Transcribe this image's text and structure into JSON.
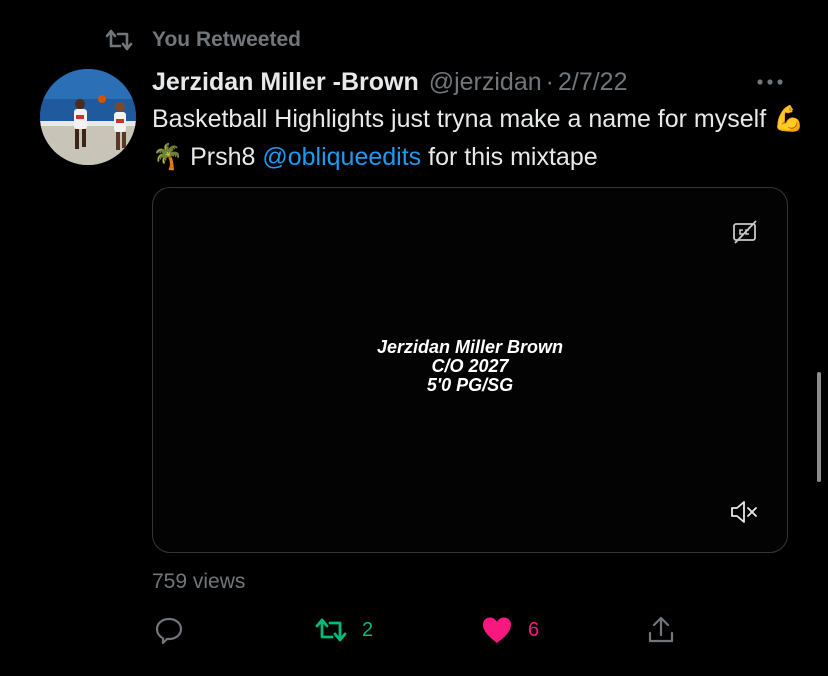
{
  "retweet_context": {
    "label": "You Retweeted",
    "icon": "retweet-icon"
  },
  "tweet": {
    "author": {
      "display_name": "Jerzidan Miller -Brown",
      "handle": "@jerzidan"
    },
    "separator": "·",
    "date": "2/7/22",
    "text": {
      "part1": "Basketball Highlights just tryna make a name for myself ",
      "emoji": "💪🌴",
      "part2": " Prsh8 ",
      "mention": "@obliqueedits",
      "part3": " for this mixtape"
    },
    "media": {
      "overlay_lines": [
        "Jerzidan Miller Brown",
        "C/O 2027",
        "5'0 PG/SG"
      ]
    },
    "views": "759 views",
    "actions": {
      "retweet_count": "2",
      "like_count": "6"
    }
  },
  "colors": {
    "background": "#000000",
    "text_primary": "#e7e9ea",
    "text_secondary": "#71767b",
    "link": "#1d9bf0",
    "retweet_active": "#00ba7c",
    "like_active": "#f91880"
  }
}
